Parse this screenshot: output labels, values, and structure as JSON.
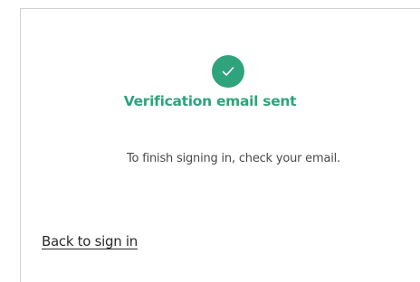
{
  "dialog": {
    "status_icon": "check-icon",
    "title": "Verification email sent",
    "message": "To finish signing in, check your email.",
    "back_link": "Back to sign in"
  },
  "colors": {
    "accent": "#2fa37c",
    "text": "#4a4a4a",
    "link": "#2a2a2a",
    "border": "#cfcfcf"
  }
}
